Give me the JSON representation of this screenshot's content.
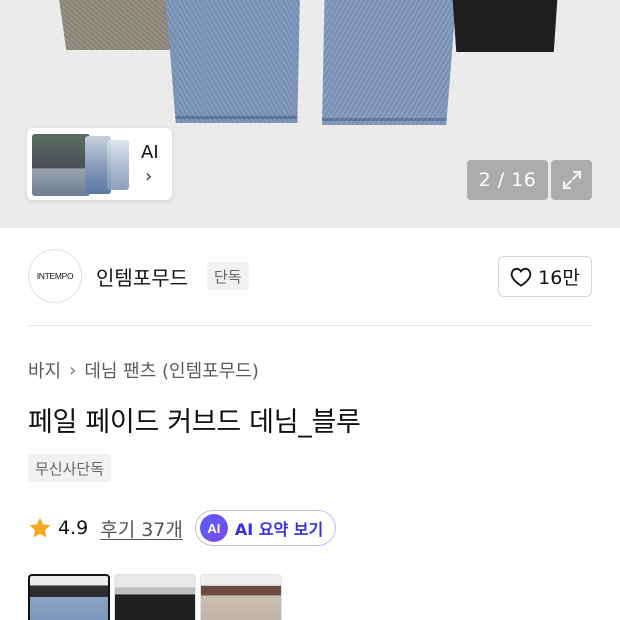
{
  "carousel": {
    "ai_thumb_label": "AI",
    "counter": "2 / 16"
  },
  "brand": {
    "logo_text": "INTEMPO",
    "name": "인템포무드",
    "badge": "단독",
    "like_count": "16만"
  },
  "breadcrumb": [
    "바지",
    "데님 팬츠 (인템포무드)"
  ],
  "product": {
    "title": "페일 페이드 커브드 데님_블루",
    "badge": "무신사단독",
    "rating": "4.9",
    "reviews": "후기 37개",
    "ai_icon": "AI",
    "ai_summary": "AI 요약 보기"
  },
  "colors": {
    "star": "#f5a623",
    "ai_purple": "#5a5cf6",
    "ai_text": "#3b2fd6"
  }
}
